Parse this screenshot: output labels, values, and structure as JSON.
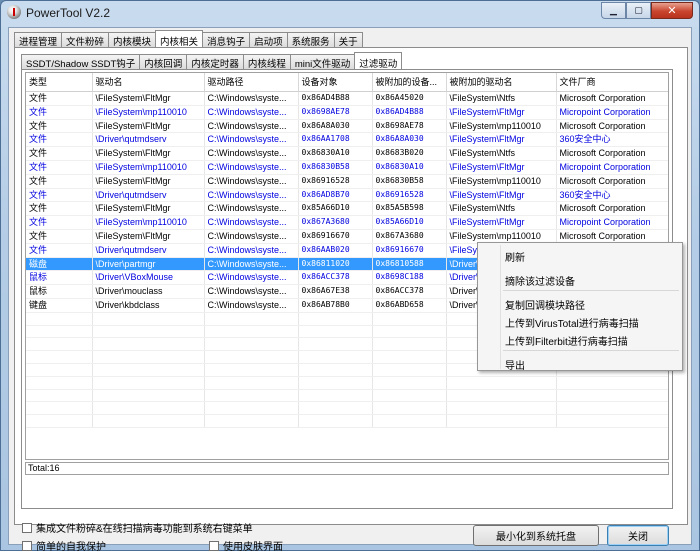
{
  "window": {
    "title": "PowerTool V2.2",
    "min": "▁",
    "max": "▢",
    "close": "✕"
  },
  "main_tabs": [
    "进程管理",
    "文件粉碎",
    "内核模块",
    "内核相关",
    "消息钩子",
    "启动项",
    "系统服务",
    "关于"
  ],
  "main_tab_active": 3,
  "sub_tabs": [
    "SSDT/Shadow SSDT钩子",
    "内核回调",
    "内核定时器",
    "内核线程",
    "mini文件驱动",
    "过滤驱动"
  ],
  "sub_tab_active": 5,
  "table": {
    "headers": [
      "类型",
      "驱动名",
      "驱动路径",
      "设备对象",
      "被附加的设备...",
      "被附加的驱动名",
      "文件厂商"
    ],
    "rows": [
      {
        "type": "文件",
        "name": "\\FileSystem\\FltMgr",
        "path": "C:\\Windows\\syste...",
        "dev": "0x86AD4B88",
        "attached": "0x86A45020",
        "attached_drv": "\\FileSystem\\Ntfs",
        "vendor": "Microsoft Corporation",
        "style": "black"
      },
      {
        "type": "文件",
        "name": "\\FileSystem\\mp110010",
        "path": "C:\\Windows\\syste...",
        "dev": "0x8698AE78",
        "attached": "0x86AD4B88",
        "attached_drv": "\\FileSystem\\FltMgr",
        "vendor": "Micropoint Corporation",
        "style": "blue"
      },
      {
        "type": "文件",
        "name": "\\FileSystem\\FltMgr",
        "path": "C:\\Windows\\syste...",
        "dev": "0x86A8A030",
        "attached": "0x8698AE78",
        "attached_drv": "\\FileSystem\\mp110010",
        "vendor": "Microsoft Corporation",
        "style": "black"
      },
      {
        "type": "文件",
        "name": "\\Driver\\qutmdserv",
        "path": "C:\\Windows\\syste...",
        "dev": "0x86AA1708",
        "attached": "0x86A8A030",
        "attached_drv": "\\FileSystem\\FltMgr",
        "vendor": "360安全中心",
        "style": "blue"
      },
      {
        "type": "文件",
        "name": "\\FileSystem\\FltMgr",
        "path": "C:\\Windows\\syste...",
        "dev": "0x86830A10",
        "attached": "0x8683B020",
        "attached_drv": "\\FileSystem\\Ntfs",
        "vendor": "Microsoft Corporation",
        "style": "black"
      },
      {
        "type": "文件",
        "name": "\\FileSystem\\mp110010",
        "path": "C:\\Windows\\syste...",
        "dev": "0x86830B58",
        "attached": "0x86830A10",
        "attached_drv": "\\FileSystem\\FltMgr",
        "vendor": "Micropoint Corporation",
        "style": "blue"
      },
      {
        "type": "文件",
        "name": "\\FileSystem\\FltMgr",
        "path": "C:\\Windows\\syste...",
        "dev": "0x86916528",
        "attached": "0x86830B58",
        "attached_drv": "\\FileSystem\\mp110010",
        "vendor": "Microsoft Corporation",
        "style": "black"
      },
      {
        "type": "文件",
        "name": "\\Driver\\qutmdserv",
        "path": "C:\\Windows\\syste...",
        "dev": "0x86AD8B70",
        "attached": "0x86916528",
        "attached_drv": "\\FileSystem\\FltMgr",
        "vendor": "360安全中心",
        "style": "blue"
      },
      {
        "type": "文件",
        "name": "\\FileSystem\\FltMgr",
        "path": "C:\\Windows\\syste...",
        "dev": "0x85A66D10",
        "attached": "0x85A5B598",
        "attached_drv": "\\FileSystem\\Ntfs",
        "vendor": "Microsoft Corporation",
        "style": "black"
      },
      {
        "type": "文件",
        "name": "\\FileSystem\\mp110010",
        "path": "C:\\Windows\\syste...",
        "dev": "0x867A3680",
        "attached": "0x85A66D10",
        "attached_drv": "\\FileSystem\\FltMgr",
        "vendor": "Micropoint Corporation",
        "style": "blue"
      },
      {
        "type": "文件",
        "name": "\\FileSystem\\FltMgr",
        "path": "C:\\Windows\\syste...",
        "dev": "0x86916670",
        "attached": "0x867A3680",
        "attached_drv": "\\FileSystem\\mp110010",
        "vendor": "Microsoft Corporation",
        "style": "black"
      },
      {
        "type": "文件",
        "name": "\\Driver\\qutmdserv",
        "path": "C:\\Windows\\syste...",
        "dev": "0x86AAB020",
        "attached": "0x86916670",
        "attached_drv": "\\FileSystem\\FltMgr",
        "vendor": "360安全中心",
        "style": "blue"
      },
      {
        "type": "磁盘",
        "name": "\\Driver\\partmgr",
        "path": "C:\\Windows\\syste...",
        "dev": "0x86811020",
        "attached": "0x86810588",
        "attached_drv": "\\Driver\\",
        "vendor": "",
        "style": "selected"
      },
      {
        "type": "鼠标",
        "name": "\\Driver\\VBoxMouse",
        "path": "C:\\Windows\\syste...",
        "dev": "0x86ACC378",
        "attached": "0x8698C188",
        "attached_drv": "\\Driver\\",
        "vendor": "",
        "style": "blue"
      },
      {
        "type": "鼠标",
        "name": "\\Driver\\mouclass",
        "path": "C:\\Windows\\syste...",
        "dev": "0x86A67E38",
        "attached": "0x86ACC378",
        "attached_drv": "\\Driver\\",
        "vendor": "",
        "style": "black"
      },
      {
        "type": "键盘",
        "name": "\\Driver\\kbdclass",
        "path": "C:\\Windows\\syste...",
        "dev": "0x86AB78B0",
        "attached": "0x86ABD658",
        "attached_drv": "\\Driver\\",
        "vendor": "",
        "style": "black"
      }
    ],
    "empty_rows": 9
  },
  "total": "Total:16",
  "context_menu": {
    "groups": [
      [
        "刷新",
        "摘除该过滤设备"
      ],
      [
        "复制回调模块路径",
        "上传到VirusTotal进行病毒扫描",
        "上传到Filterbit进行病毒扫描"
      ],
      [
        "导出"
      ]
    ]
  },
  "options": {
    "integrate": "集成文件粉碎&在线扫描病毒功能到系统右键菜单",
    "self_protect": "简单的自我保护",
    "skin": "使用皮肤界面"
  },
  "buttons": {
    "minimize_tray": "最小化到系统托盘",
    "close": "关闭"
  },
  "colors": {
    "selection": "#3399ff",
    "highlight_text": "#0000e0"
  }
}
